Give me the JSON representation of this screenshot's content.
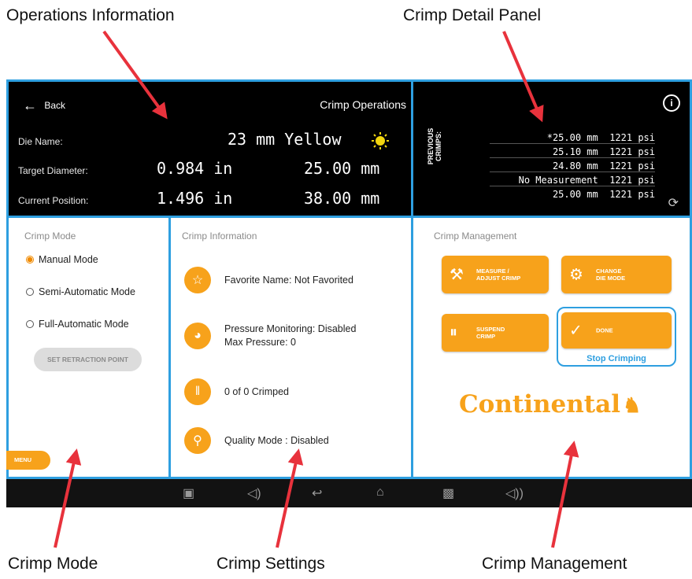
{
  "callouts": {
    "operations": "Operations Information",
    "detail": "Crimp Detail Panel",
    "mode": "Crimp Mode",
    "settings": "Crimp Settings",
    "management": "Crimp Management"
  },
  "ops": {
    "back_label": "Back",
    "title": "Crimp Operations",
    "die_name_label": "Die Name:",
    "die_name_value": "23 mm Yellow",
    "die_color": "#f2d50f",
    "target_label": "Target Diameter:",
    "target_in": "0.984 in",
    "target_mm": "25.00 mm",
    "position_label": "Current Position:",
    "position_in": "1.496 in",
    "position_mm": "38.00 mm"
  },
  "detail": {
    "previous_label": "PREVIOUS CRIMPS:",
    "rows": [
      {
        "measure": "*25.00 mm",
        "pressure": "1221 psi"
      },
      {
        "measure": "25.10 mm",
        "pressure": "1221 psi"
      },
      {
        "measure": "24.80 mm",
        "pressure": "1221 psi"
      },
      {
        "measure": "No Measurement",
        "pressure": "1221 psi"
      },
      {
        "measure": "25.00 mm",
        "pressure": "1221 psi"
      }
    ]
  },
  "mode": {
    "title": "Crimp Mode",
    "options": [
      "Manual Mode",
      "Semi-Automatic Mode",
      "Full-Automatic Mode"
    ],
    "selected": "Manual Mode",
    "retraction_button": "SET RETRACTION POINT",
    "menu_button": "MENU"
  },
  "info": {
    "title": "Crimp Information",
    "favorite": "Favorite Name: Not Favorited",
    "pressure_line1": "Pressure Monitoring: Disabled",
    "pressure_line2": "Max Pressure: 0",
    "crimped": "0 of 0 Crimped",
    "quality": "Quality Mode : Disabled"
  },
  "mgmt": {
    "title": "Crimp Management",
    "measure_line1": "MEASURE /",
    "measure_line2": "ADJUST CRIMP",
    "change_line1": "CHANGE",
    "change_line2": "DIE MODE",
    "suspend_line1": "SUSPEND",
    "suspend_line2": "CRIMP",
    "done": "DONE",
    "stop": "Stop Crimping",
    "logo": "Continental"
  },
  "colors": {
    "accent": "#f7a21b",
    "panel_border": "#2e9fe0",
    "arrow": "#e8323c"
  }
}
